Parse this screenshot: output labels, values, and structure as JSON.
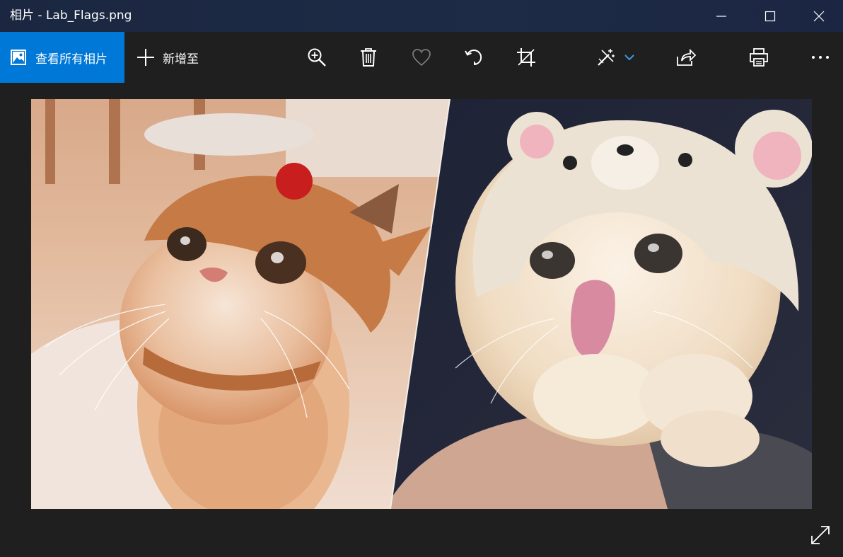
{
  "window": {
    "title": "相片 - Lab_Flags.png"
  },
  "toolbar": {
    "view_all_label": "查看所有相片",
    "add_to_label": "新增至"
  },
  "icons": {
    "view_all": "image-gallery-icon",
    "add_to": "plus-icon",
    "zoom": "zoom-in-icon",
    "delete": "trash-icon",
    "favorite": "heart-icon",
    "rotate": "rotate-icon",
    "crop": "crop-icon",
    "edit": "edit-wand-icon",
    "edit_menu": "chevron-down-icon",
    "share": "share-icon",
    "print": "printer-icon",
    "more": "more-icon",
    "fullscreen": "expand-icon",
    "minimize": "minimize-icon",
    "maximize": "maximize-icon",
    "close": "close-icon"
  },
  "colors": {
    "accent": "#0078d7",
    "titlebar": "#1b2740",
    "toolbar": "#1f1f1f",
    "favorite_disabled": "#7a7a7a"
  }
}
